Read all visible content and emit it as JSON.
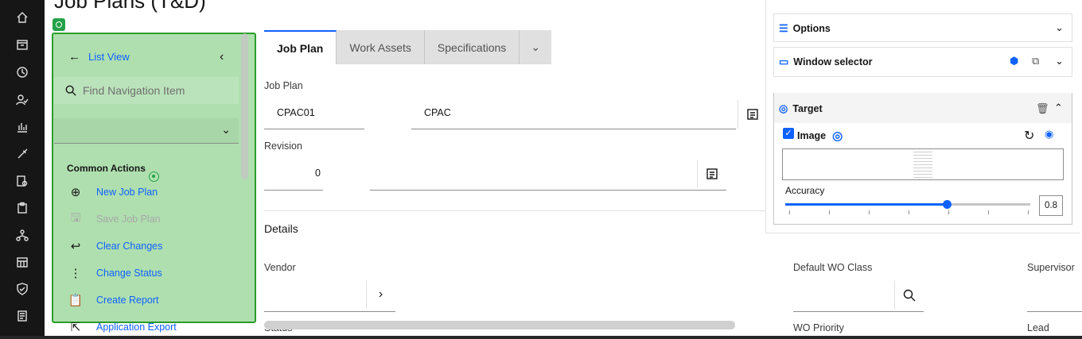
{
  "page": {
    "title": "Job Plans (T&D)"
  },
  "rail": {
    "items": [
      "home-icon",
      "calendar-icon",
      "history-icon",
      "person-check-icon",
      "chart-icon",
      "rocket-icon",
      "search-doc-icon",
      "clipboard-icon",
      "network-icon",
      "calendar-grid-icon",
      "shield-icon",
      "document-icon"
    ]
  },
  "nav": {
    "list_view": "List View",
    "search_placeholder": "Find Navigation Item",
    "common_actions": "Common Actions",
    "actions": [
      {
        "label": "New Job Plan",
        "icon": "add-circle-icon",
        "enabled": true
      },
      {
        "label": "Save Job Plan",
        "icon": "save-icon",
        "enabled": false
      },
      {
        "label": "Clear Changes",
        "icon": "undo-icon",
        "enabled": true
      },
      {
        "label": "Change Status",
        "icon": "status-icon",
        "enabled": true
      },
      {
        "label": "Create Report",
        "icon": "report-icon",
        "enabled": true
      },
      {
        "label": "Application Export",
        "icon": "export-icon",
        "enabled": true
      }
    ]
  },
  "tabs": [
    "Job Plan",
    "Work Assets",
    "Specifications"
  ],
  "form": {
    "job_plan_label": "Job Plan",
    "job_plan_value": "CPAC01",
    "job_plan_desc": "CPAC",
    "revision_label": "Revision",
    "revision_value": "0",
    "details_title": "Details",
    "vendor_label": "Vendor",
    "status_label": "Status",
    "default_wo_class_label": "Default WO Class",
    "wo_priority_label": "WO Priority",
    "supervisor_label": "Supervisor",
    "lead_label": "Lead"
  },
  "float_panel": {
    "options_label": "Options",
    "window_selector_label": "Window selector",
    "target_label": "Target",
    "image_label": "Image",
    "image_checked": true,
    "accuracy_label": "Accuracy",
    "accuracy_value": "0.8",
    "accuracy_fraction": 0.66,
    "accent": "#0f62fe"
  },
  "colors": {
    "overlay": "#6ec46e",
    "overlay_border": "#2a9d2a",
    "link": "#0f62fe",
    "rail": "#161616"
  }
}
